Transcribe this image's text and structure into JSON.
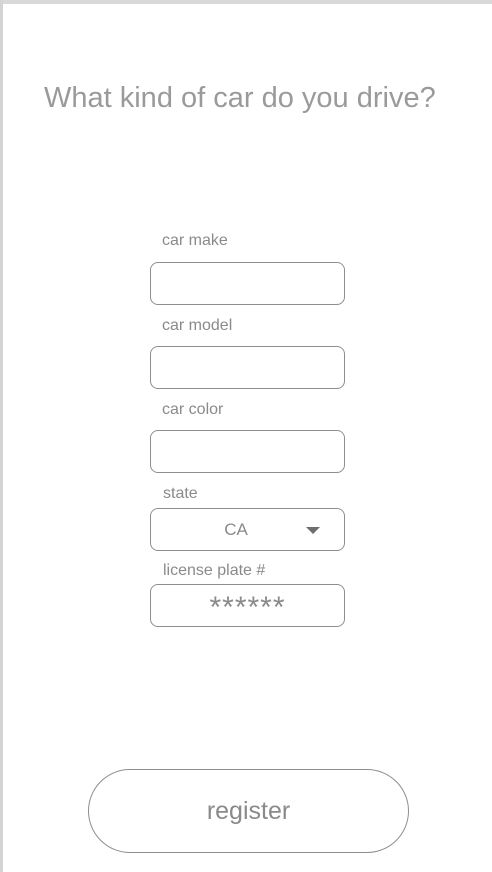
{
  "title": "What kind of car do you drive?",
  "form": {
    "car_make": {
      "label": "car make",
      "value": ""
    },
    "car_model": {
      "label": "car model",
      "value": ""
    },
    "car_color": {
      "label": "car color",
      "value": ""
    },
    "state": {
      "label": "state",
      "selected": "CA"
    },
    "license_plate": {
      "label": "license plate #",
      "masked_value": "******"
    }
  },
  "register_label": "register"
}
